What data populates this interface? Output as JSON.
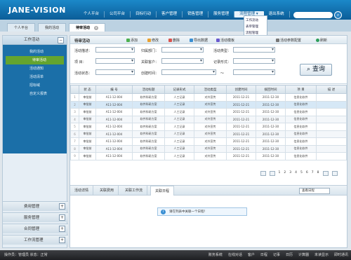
{
  "app": {
    "logo": "JANE-VISION"
  },
  "top_menu": [
    "个人平台",
    "公司平台",
    "目标行动",
    "客户管理",
    "销售管理",
    "服务管理",
    "流程管理 ▾",
    "退出系统"
  ],
  "dropdown": [
    "工作流动",
    "表单管理",
    "流程管理",
    "工作流管理"
  ],
  "tabs": [
    {
      "label": "个人平台"
    },
    {
      "label": "我的活动"
    },
    {
      "label": "待审活动"
    }
  ],
  "sidebar": {
    "head": "工作活动",
    "items": [
      "我的活动",
      "待审活动",
      "活动通知",
      "活动清单",
      "招标域",
      "自定义报表"
    ],
    "footers": [
      "费用管理",
      "服务管理",
      "合同管理",
      "工作流管理"
    ]
  },
  "main": {
    "title": "待审活动",
    "toolbar": [
      "添加",
      "修改",
      "删除",
      "导出数据",
      "活动模板"
    ],
    "toolbar_right": [
      "活动参数配置",
      "刷新"
    ],
    "form_labels": [
      "活动描述：",
      "归属部门：",
      "活动类型：",
      "项    目：",
      "关联客户：",
      "记录形式：",
      "活动状态：",
      "创建时间：",
      "～"
    ],
    "query": "查询",
    "columns": [
      "",
      "状 态",
      "编 号",
      "活动标题",
      "记录形式",
      "活动类型",
      "创建时间",
      "拨回时间",
      "项 目",
      "描 述"
    ],
    "rows": [
      [
        "1",
        "审批前",
        "A11-12-004",
        "软件科研方案",
        "人工记录",
        "对外宣传",
        "2011-12-21",
        "2011-12-30",
        "信息化软件",
        ""
      ],
      [
        "2",
        "审批前",
        "A11-12-004",
        "软件科研方案",
        "人工记录",
        "对外宣传",
        "2011-12-21",
        "2011-12-30",
        "信息化软件",
        ""
      ],
      [
        "3",
        "审批前",
        "A11-12-004",
        "软件科研方案",
        "人工记录",
        "对外宣传",
        "2011-12-21",
        "2011-12-30",
        "信息化软件",
        ""
      ],
      [
        "4",
        "审批前",
        "A11-12-004",
        "软件科研方案",
        "人工记录",
        "对外宣传",
        "2011-12-21",
        "2011-12-30",
        "信息化软件",
        ""
      ],
      [
        "5",
        "审批前",
        "A11-12-004",
        "软件科研方案",
        "人工记录",
        "对外宣传",
        "2011-12-21",
        "2011-12-30",
        "信息化软件",
        ""
      ],
      [
        "6",
        "审批前",
        "A11-12-004",
        "软件科研方案",
        "人工记录",
        "对外宣传",
        "2011-12-21",
        "2011-12-30",
        "信息化软件",
        ""
      ],
      [
        "7",
        "审批前",
        "A11-12-004",
        "软件科研方案",
        "人工记录",
        "对外宣传",
        "2011-12-21",
        "2011-12-30",
        "信息化软件",
        ""
      ],
      [
        "8",
        "审批前",
        "A11-12-004",
        "软件科研方案",
        "人工记录",
        "对外宣传",
        "2011-12-21",
        "2011-12-30",
        "信息化软件",
        ""
      ],
      [
        "9",
        "审批前",
        "A11-12-004",
        "软件科研方案",
        "人工记录",
        "对外宣传",
        "2011-12-21",
        "2011-12-30",
        "信息化软件",
        ""
      ]
    ],
    "pager": [
      "1",
      "2",
      "3",
      "4",
      "5",
      "6",
      "7",
      "8"
    ],
    "subtabs": [
      "活动详情",
      "关联费用",
      "关联工作流",
      "关联日程"
    ],
    "subtab_select": "查看日程",
    "message": "请在列表中关联一个日程！"
  },
  "status": {
    "left": "操作员：管理员    状态：正常",
    "right": [
      "账务系统",
      "在线对话",
      "客户",
      "日程",
      "记事",
      "日历",
      "计算器",
      "未读显示",
      "即时通讯"
    ]
  }
}
